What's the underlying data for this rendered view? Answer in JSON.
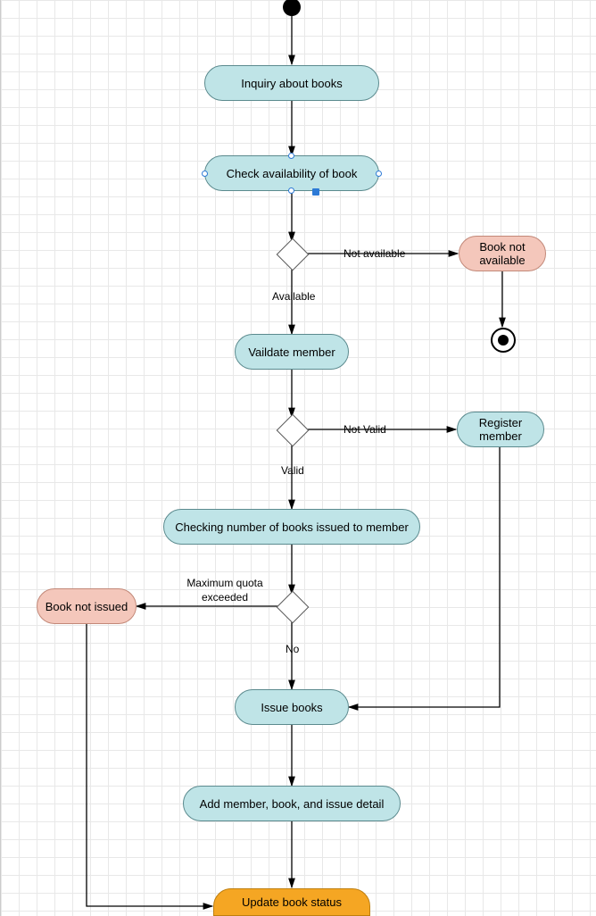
{
  "nodes": {
    "inquiry": "Inquiry about books",
    "check_availability": "Check availability of book",
    "book_not_available": "Book not available",
    "validate_member": "Vaildate member",
    "register_member": "Register member",
    "checking_books": "Checking number of books issued to member",
    "book_not_issued": "Book not issued",
    "issue_books": "Issue books",
    "add_detail": "Add member, book, and issue detail",
    "update_status": "Update book status"
  },
  "labels": {
    "not_available": "Not available",
    "available": "Available",
    "not_valid": "Not Valid",
    "valid": "Valid",
    "max_quota": "Maximum quota exceeded",
    "no": "No"
  }
}
